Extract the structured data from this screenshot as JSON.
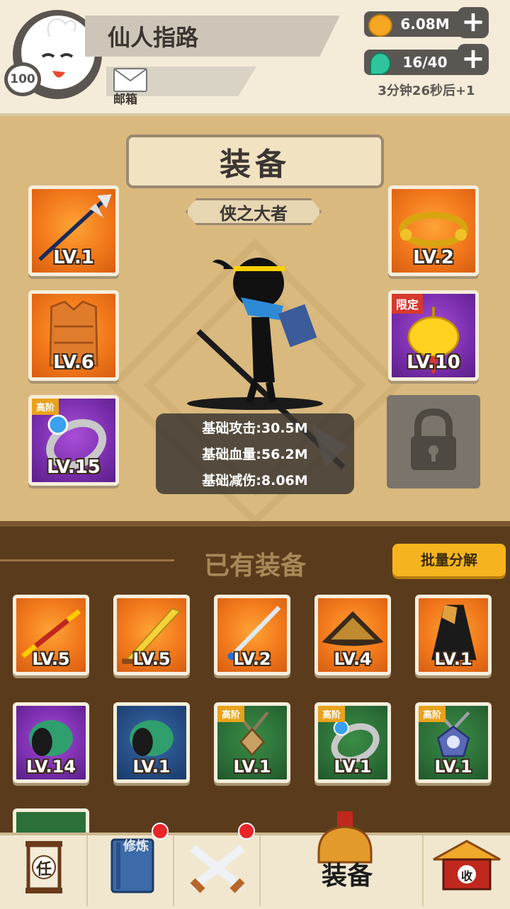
{
  "header": {
    "player_name": "仙人指路",
    "level": "100",
    "mail_label": "邮箱",
    "coins": "6.08M",
    "energy": "16/40",
    "energy_timer": "3分钟26秒后+1"
  },
  "equip_panel": {
    "title": "装备",
    "rank_title": "侠之大者",
    "slots": [
      {
        "name": "weapon-halberd",
        "level": "LV.1"
      },
      {
        "name": "armor-vest",
        "level": "LV.6"
      },
      {
        "name": "ring-sapphire",
        "level": "LV.15",
        "tag": "高阶"
      },
      {
        "name": "headband-gold",
        "level": "LV.2"
      },
      {
        "name": "pendant-gold",
        "level": "LV.10",
        "tag": "限定"
      }
    ],
    "stats": [
      "基础攻击:30.5M",
      "基础血量:56.2M",
      "基础减伤:8.06M"
    ]
  },
  "inventory": {
    "title": "已有装备",
    "bulk_button": "批量分解",
    "items": [
      {
        "name": "staff",
        "level": "LV.5",
        "color": "orange"
      },
      {
        "name": "golden-saber",
        "level": "LV.5",
        "color": "orange"
      },
      {
        "name": "sword",
        "level": "LV.2",
        "color": "orange"
      },
      {
        "name": "straw-hat",
        "level": "LV.4",
        "color": "orange"
      },
      {
        "name": "cape",
        "level": "LV.1",
        "color": "orange"
      },
      {
        "name": "bracer-green",
        "level": "LV.14",
        "color": "purple"
      },
      {
        "name": "bracer-green-2",
        "level": "LV.1",
        "color": "blue"
      },
      {
        "name": "amulet-bronze",
        "level": "LV.1",
        "color": "green",
        "tag": "高阶"
      },
      {
        "name": "ring-blue",
        "level": "LV.1",
        "color": "green",
        "tag": "高阶"
      },
      {
        "name": "amulet-sapphire",
        "level": "LV.1",
        "color": "green",
        "tag": "高阶"
      }
    ]
  },
  "nav": {
    "task_glyph": "任",
    "cultivate_glyph": "修炼",
    "equip_label": "装备",
    "collect_glyph": "收"
  },
  "colors": {
    "accent": "#f5b41d",
    "panel": "#d9b97e",
    "inventory_bg": "#5a3c1c"
  }
}
